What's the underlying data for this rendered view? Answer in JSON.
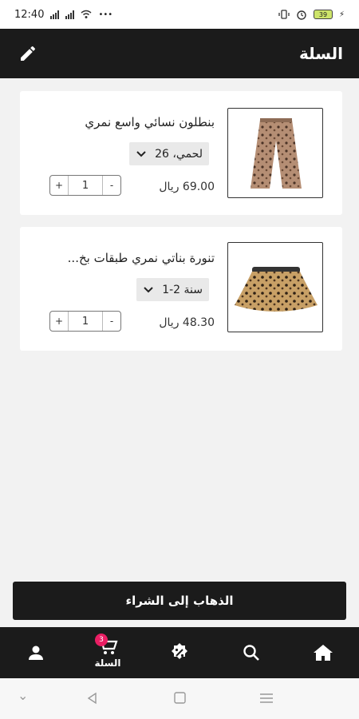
{
  "status_bar": {
    "time": "12:40",
    "battery": "39"
  },
  "header": {
    "title": "السلة"
  },
  "cart": {
    "items": [
      {
        "name": "بنطلون نسائي واسع نمري",
        "variant": "لحمي، 26",
        "price": "69.00 ريال",
        "quantity": "1"
      },
      {
        "name": "تنورة بناتي نمري طبقات بخ...",
        "variant": "1-2 سنة",
        "price": "48.30 ريال",
        "quantity": "1"
      }
    ],
    "qty_plus": "+",
    "qty_minus": "-"
  },
  "checkout_button": {
    "label": "الذهاب إلى الشراء"
  },
  "bottom_nav": {
    "cart_label": "السلة",
    "cart_badge": "3"
  },
  "colors": {
    "bar": "#1b1b1b",
    "badge": "#e91e63",
    "background": "#f2f2f2"
  }
}
